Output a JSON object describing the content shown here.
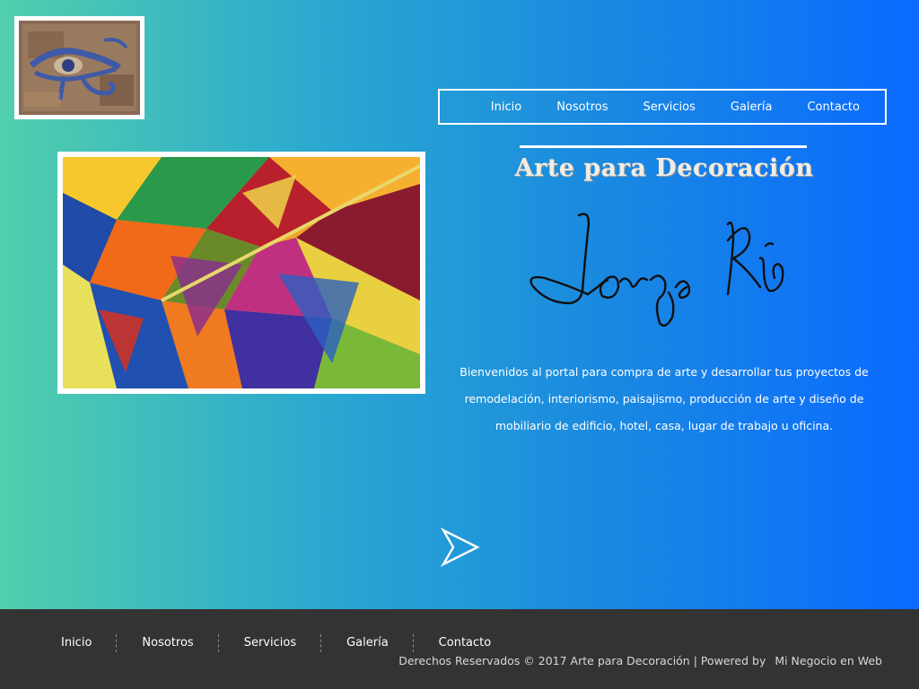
{
  "colors": {
    "hero_gradient_start": "#52cfac",
    "hero_gradient_end": "#0a6aff",
    "footer_bg": "#333333",
    "text": "#ffffff"
  },
  "header": {
    "logo_icon": "eye-of-horus-icon",
    "nav": [
      {
        "label": "Inicio"
      },
      {
        "label": "Nosotros"
      },
      {
        "label": "Servicios"
      },
      {
        "label": "Galería"
      },
      {
        "label": "Contacto"
      }
    ]
  },
  "main": {
    "painting_icon": "abstract-painting-image",
    "title": "Arte para Decoración",
    "signature_icon": "signature-jorge-rio",
    "welcome_text": "Bienvenidos al portal para compra de arte y desarrollar tus proyectos de remodelación, interiorismo, paisajismo, producción de arte y diseño de mobiliario de edificio, hotel, casa, lugar de trabajo u oficina.",
    "next_icon": "arrow-right-icon"
  },
  "footer": {
    "nav": [
      {
        "label": "Inicio"
      },
      {
        "label": "Nosotros"
      },
      {
        "label": "Servicios"
      },
      {
        "label": "Galería"
      },
      {
        "label": "Contacto"
      }
    ],
    "copyright": "Derechos Reservados © 2017 Arte para Decoración | Powered by",
    "powered_by": "Mi Negocio en Web"
  }
}
